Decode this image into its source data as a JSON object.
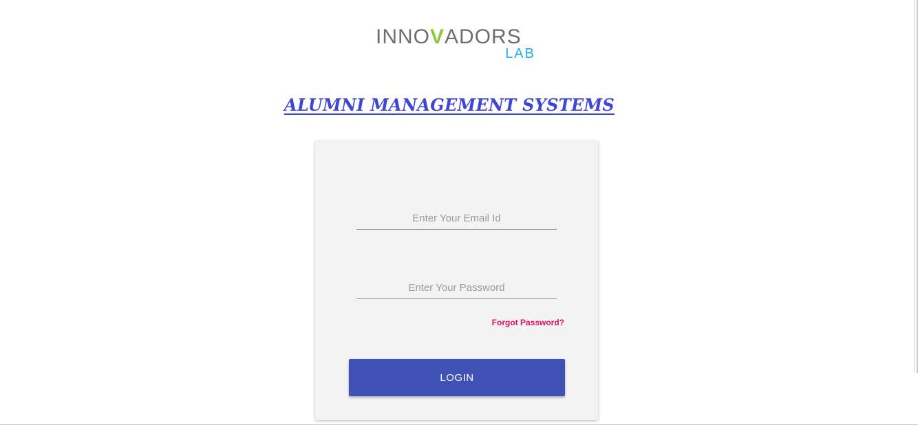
{
  "logo": {
    "main_prefix": "INNO",
    "main_accent": "V",
    "main_suffix": "ADORS",
    "sub": "LAB",
    "colors": {
      "gray": "#6d6e71",
      "green": "#8dc63f",
      "blue": "#27aae1"
    }
  },
  "heading": {
    "title": "ALUMNI MANAGEMENT SYSTEMS",
    "color": "#3f46d6"
  },
  "login_form": {
    "email_placeholder": "Enter Your Email Id",
    "password_placeholder": "Enter Your Password",
    "forgot_label": "Forgot Password?",
    "login_label": "LOGIN",
    "accent_color": "#3f51b5",
    "forgot_color": "#e0115f"
  }
}
